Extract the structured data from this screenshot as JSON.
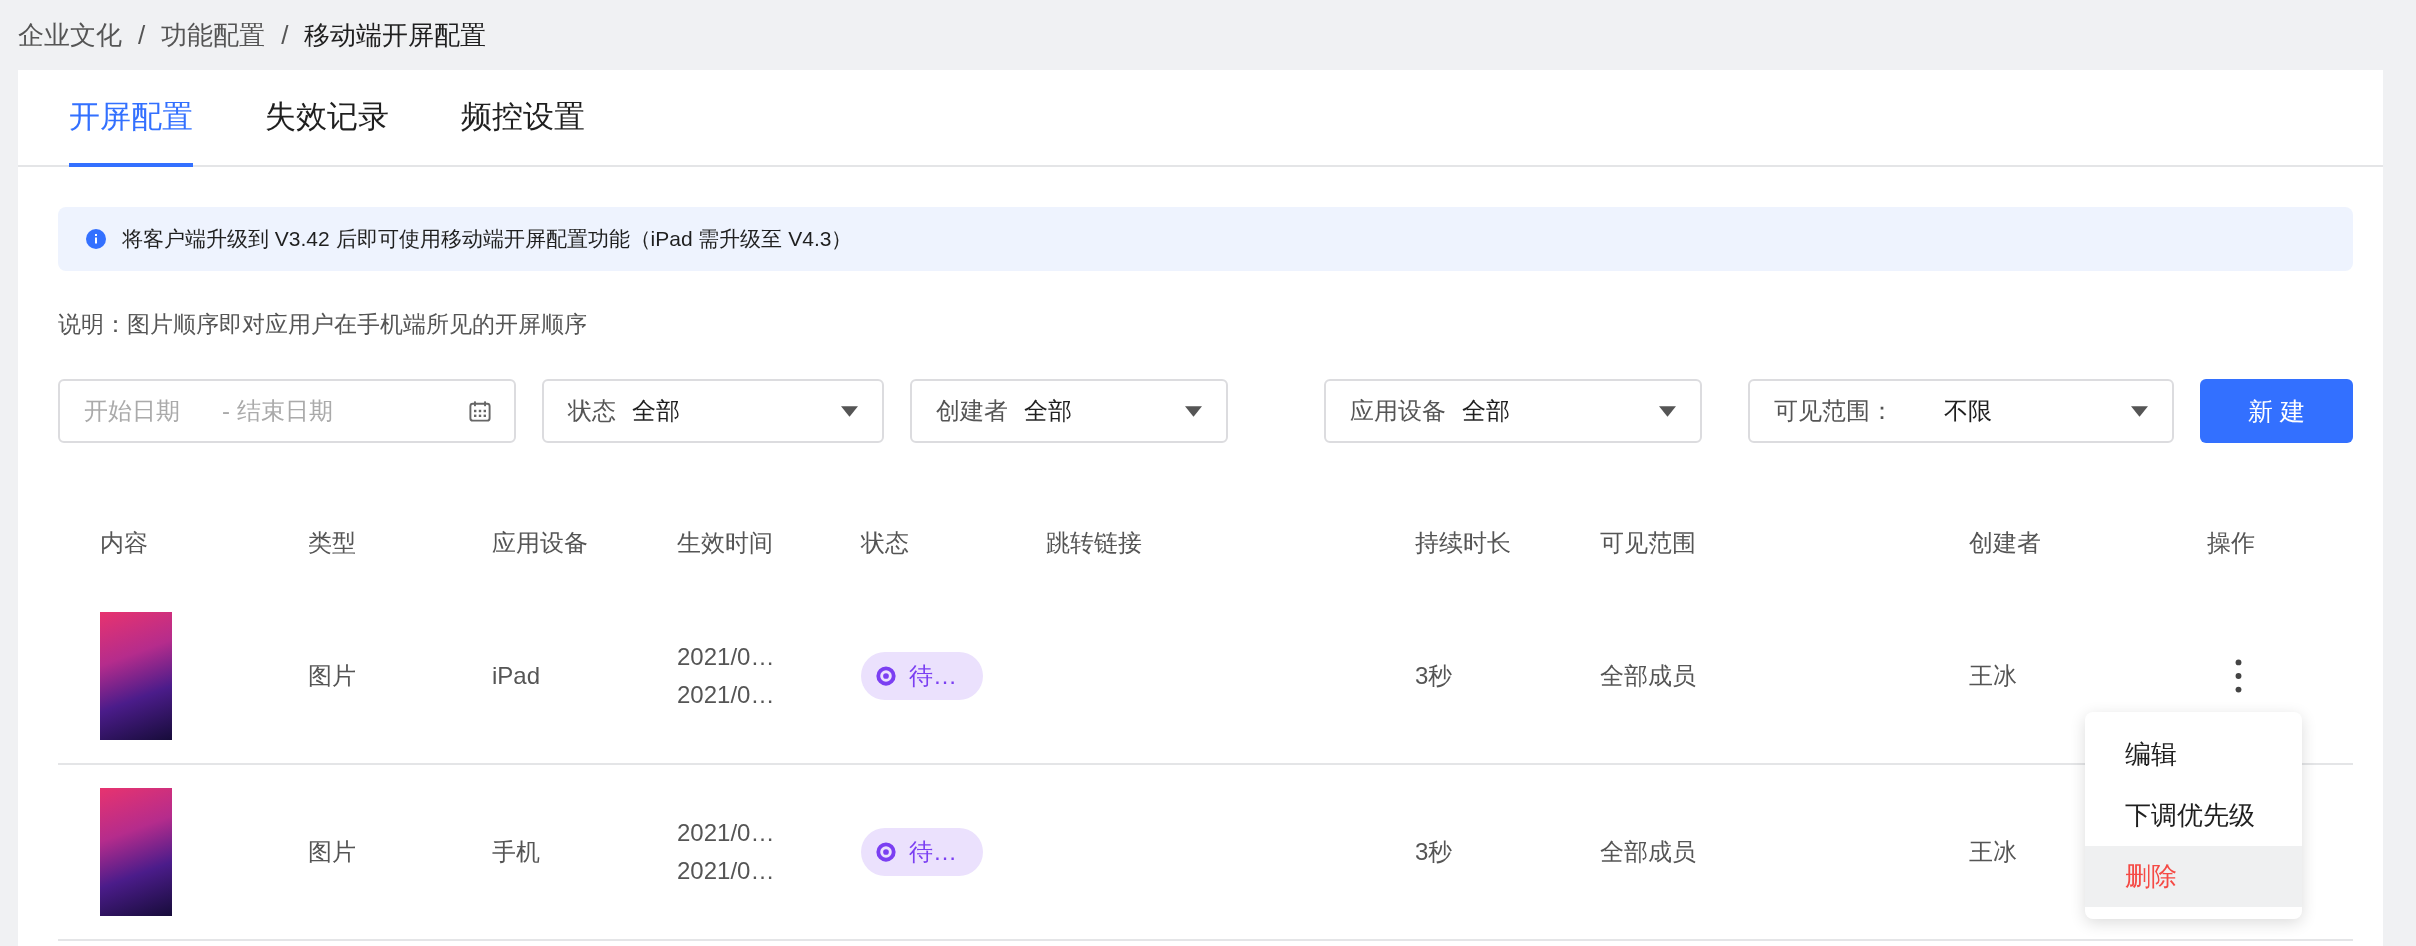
{
  "breadcrumb": [
    {
      "kind": "link",
      "label": "企业文化"
    },
    {
      "kind": "separator",
      "label": "/"
    },
    {
      "kind": "link",
      "label": "功能配置"
    },
    {
      "kind": "separator",
      "label": "/"
    },
    {
      "kind": "current",
      "label": "移动端开屏配置"
    }
  ],
  "tabs": [
    {
      "label": "开屏配置",
      "selected": true
    },
    {
      "label": "失效记录",
      "selected": false
    },
    {
      "label": "频控设置",
      "selected": false
    }
  ],
  "alert": {
    "text": "将客户端升级到 V3.42 后即可使用移动端开屏配置功能（iPad 需升级至 V4.3）"
  },
  "note": "说明：图片顺序即对应用户在手机端所见的开屏顺序",
  "date_range": {
    "start_placeholder": "开始日期",
    "end_placeholder": "- 结束日期"
  },
  "filters": [
    {
      "label": "状态",
      "value": "全部"
    },
    {
      "label": "创建者",
      "value": "全部"
    },
    {
      "label": "应用设备",
      "value": "全部"
    },
    {
      "label": "可见范围：",
      "value": "不限"
    }
  ],
  "new_button": "新 建",
  "table": {
    "columns": [
      "内容",
      "类型",
      "应用设备",
      "生效时间",
      "状态",
      "跳转链接",
      "持续时长",
      "可见范围",
      "创建者",
      "操作"
    ],
    "rows": [
      {
        "type": "图片",
        "device": "iPad",
        "start": "2021/0…",
        "end": "2021/0…",
        "status": "待…",
        "duration": "3秒",
        "scope": "全部成员",
        "creator": "王冰",
        "menu_open": true
      },
      {
        "type": "图片",
        "device": "手机",
        "start": "2021/0…",
        "end": "2021/0…",
        "status": "待…",
        "duration": "3秒",
        "scope": "全部成员",
        "creator": "王冰",
        "menu_open": false
      }
    ]
  },
  "menu": [
    {
      "label": "编辑",
      "kind": "normal",
      "highlighted": false
    },
    {
      "label": "下调优先级",
      "kind": "normal",
      "highlighted": false
    },
    {
      "label": "删除",
      "kind": "danger",
      "highlighted": true
    }
  ]
}
